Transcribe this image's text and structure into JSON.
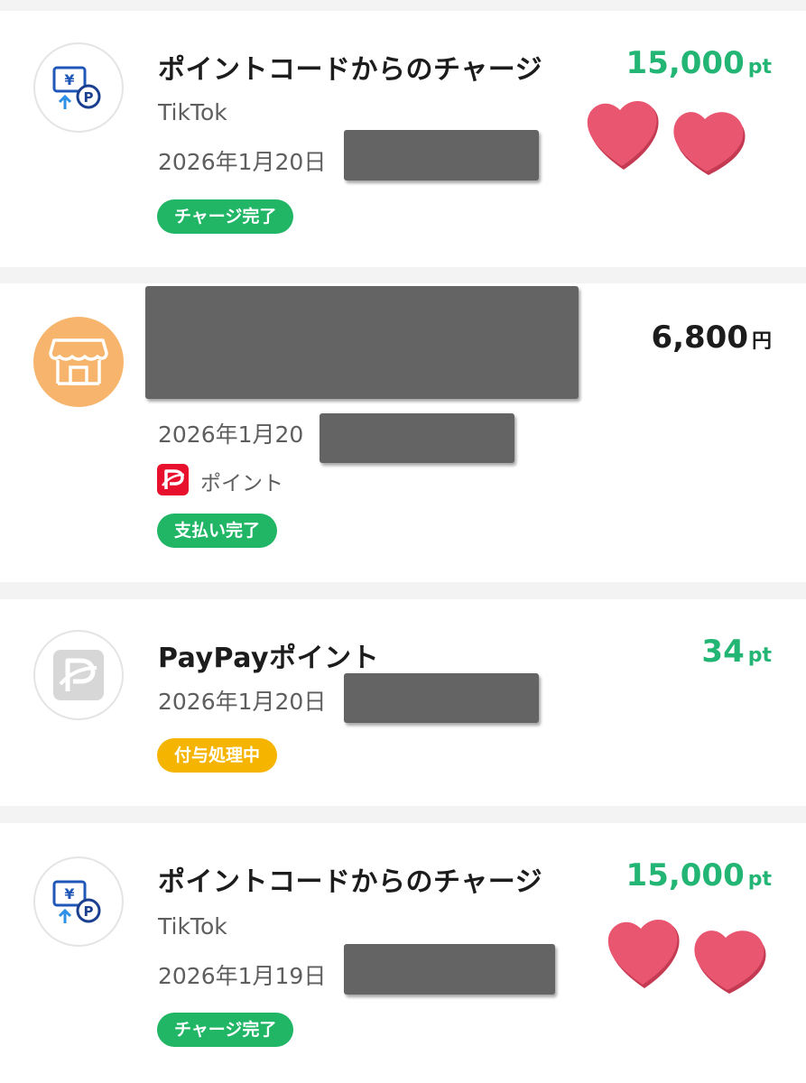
{
  "colors": {
    "accent_green": "#22b573",
    "badge_green": "#21b566",
    "badge_yellow": "#f5b400",
    "store_icon_bg": "#f7b46c",
    "paypay_red": "#e8112d",
    "heart": "#e85670"
  },
  "transactions": [
    {
      "icon": "point-code-charge-icon",
      "title": "ポイントコードからのチャージ",
      "subtitle": "TikTok",
      "date": "2026年1月20日",
      "badge": "チャージ完了",
      "amount": "15,000",
      "unit": "pt"
    },
    {
      "icon": "store-icon",
      "date": "2026年1月20",
      "payment_method": "ポイント",
      "badge": "支払い完了",
      "amount": "6,800",
      "unit": "円"
    },
    {
      "icon": "paypay-point-icon",
      "title": "PayPayポイント",
      "date": "2026年1月20日",
      "badge": "付与処理中",
      "amount": "34",
      "unit": "pt"
    },
    {
      "icon": "point-code-charge-icon",
      "title": "ポイントコードからのチャージ",
      "subtitle": "TikTok",
      "date": "2026年1月19日",
      "badge": "チャージ完了",
      "amount": "15,000",
      "unit": "pt"
    }
  ]
}
